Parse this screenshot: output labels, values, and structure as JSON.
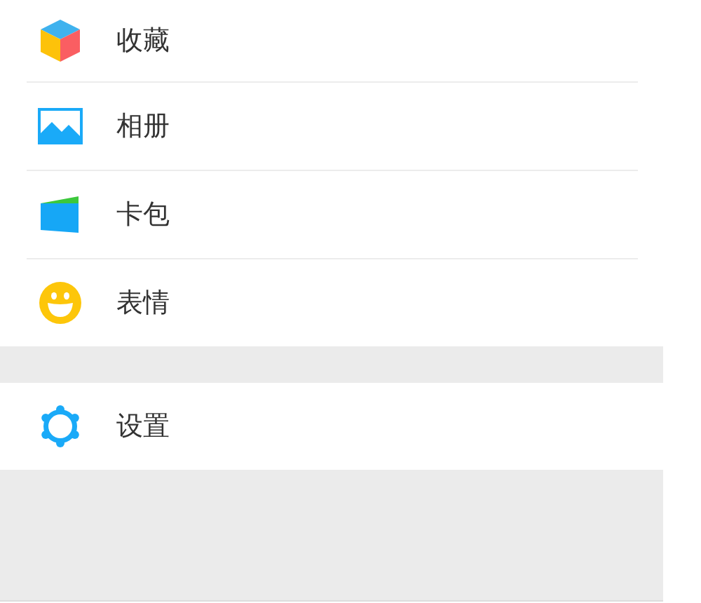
{
  "groups": [
    {
      "items": [
        {
          "label": "收藏"
        },
        {
          "label": "相册"
        },
        {
          "label": "卡包"
        },
        {
          "label": "表情"
        }
      ]
    },
    {
      "items": [
        {
          "label": "设置"
        }
      ]
    }
  ]
}
